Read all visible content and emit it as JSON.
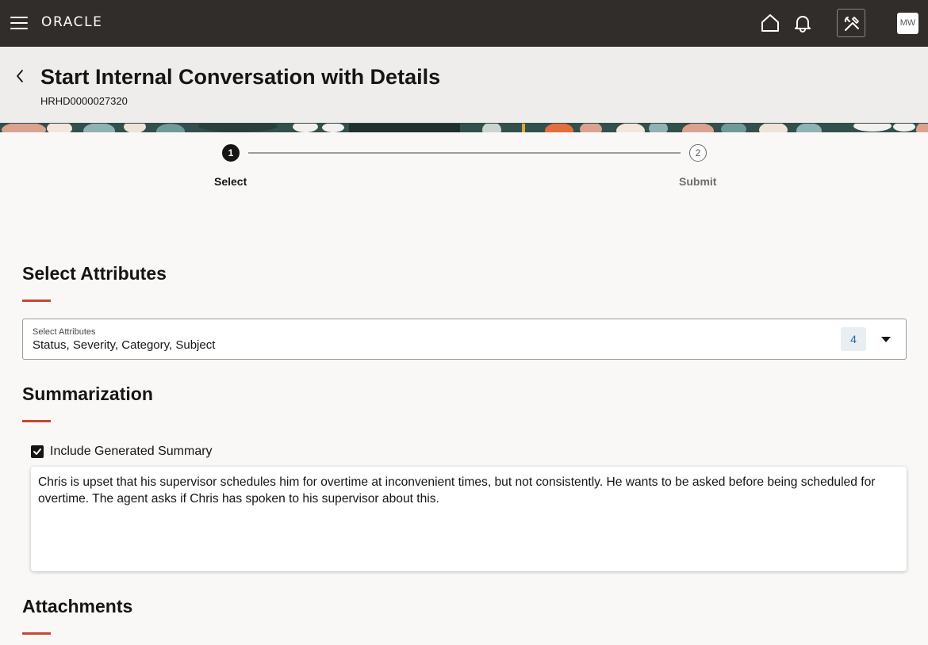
{
  "nav": {
    "logo": "ORACLE",
    "avatar_initials": "MW",
    "icons": [
      "menu-icon",
      "home-icon",
      "bell-icon",
      "tools-icon"
    ]
  },
  "header": {
    "title": "Start Internal Conversation with Details",
    "reference_id": "HRHD0000027320"
  },
  "train": {
    "steps": [
      {
        "number": "1",
        "label": "Select",
        "state": "active"
      },
      {
        "number": "2",
        "label": "Submit",
        "state": "pending"
      }
    ]
  },
  "select_attributes": {
    "section_title": "Select Attributes",
    "field_label": "Select Attributes",
    "field_value": "Status, Severity, Category, Subject",
    "selected_count": "4"
  },
  "summarization": {
    "section_title": "Summarization",
    "checkbox_label": "Include Generated Summary",
    "checkbox_checked": true,
    "summary_text": "Chris is upset that his supervisor schedules him for overtime at inconvenient times, but not consistently. He wants to be asked before being scheduled for overtime. The agent asks if Chris has spoken to his supervisor about this."
  },
  "attachments": {
    "section_title": "Attachments"
  },
  "colors": {
    "topbar": "#312d2a",
    "header_bg": "#eeedeb",
    "page_bg": "#f9f8f6",
    "accent_underline": "#c74634",
    "count_badge_text": "#2d6694"
  }
}
